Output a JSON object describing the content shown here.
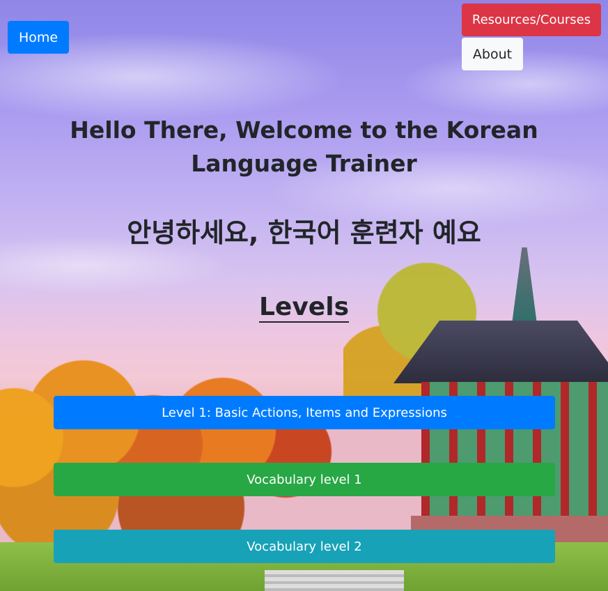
{
  "nav": {
    "home_label": "Home",
    "resources_label": "Resources/Courses",
    "about_label": "About"
  },
  "main": {
    "title": "Hello There, Welcome to the Korean Language Trainer",
    "korean_greeting": "안녕하세요, 한국어 훈련자 예요",
    "levels_heading": "Levels"
  },
  "levels": [
    {
      "label": "Level 1: Basic Actions, Items and Expressions",
      "color": "#007bff"
    },
    {
      "label": "Vocabulary level 1",
      "color": "#28a745"
    },
    {
      "label": "Vocabulary level 2",
      "color": "#17a2b8"
    }
  ],
  "colors": {
    "home": "#007bff",
    "resources": "#dc3545",
    "about": "#f8f9fa",
    "text": "#212529"
  },
  "background": {
    "icon": "korean-pavilion-autumn-landscape"
  }
}
